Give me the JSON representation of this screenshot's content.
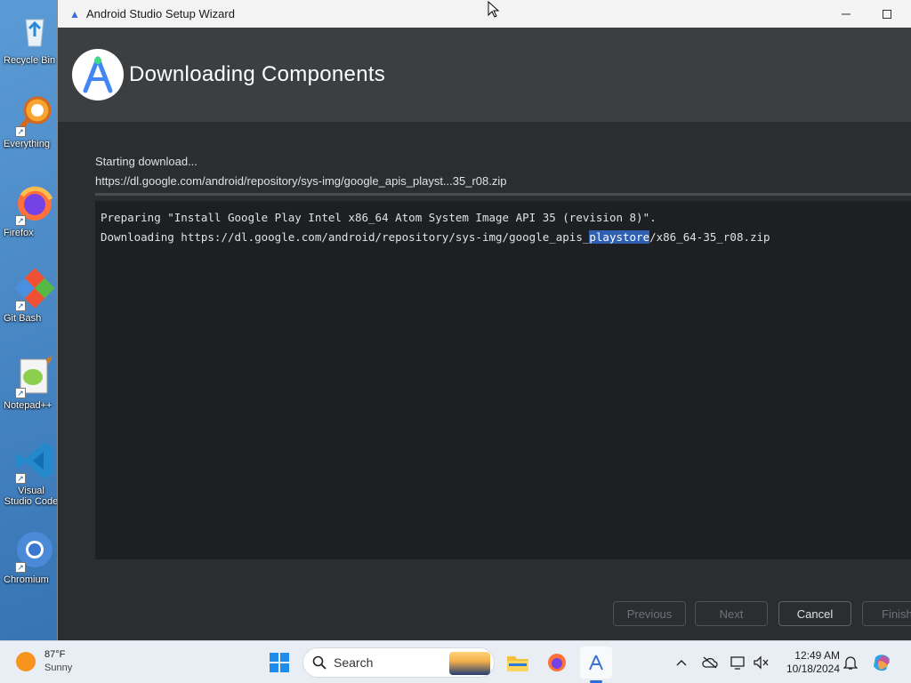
{
  "desktop": {
    "icons": [
      {
        "label": "Recycle Bin"
      },
      {
        "label": "Everything"
      },
      {
        "label": "Firefox"
      },
      {
        "label": "Git Bash"
      },
      {
        "label": "Notepad++"
      },
      {
        "label": "Visual Studio Code"
      },
      {
        "label": "Chromium"
      }
    ]
  },
  "window": {
    "title": "Android Studio Setup Wizard",
    "header_title": "Downloading Components",
    "status_text": "Starting download...",
    "download_url": "https://dl.google.com/android/repository/sys-img/google_apis_playst...35_r08.zip",
    "progress": 0,
    "log": {
      "line1": "Preparing \"Install Google Play Intel x86_64 Atom System Image API 35 (revision 8)\".",
      "line2_prefix": "Downloading https://dl.google.com/android/repository/sys-img/google_apis_",
      "line2_selected": "playstore",
      "line2_suffix": "/x86_64-35_r08.zip"
    },
    "buttons": {
      "previous": "Previous",
      "next": "Next",
      "cancel": "Cancel",
      "finish": "Finish"
    }
  },
  "taskbar": {
    "weather_temp": "87°F",
    "weather_cond": "Sunny",
    "search_label": "Search",
    "time": "12:49 AM",
    "date": "10/18/2024"
  },
  "colors": {
    "accent": "#3d6fd6",
    "selection": "#2f5fb0",
    "header_bg": "#3c3f41",
    "log_bg": "#1e1f22"
  }
}
